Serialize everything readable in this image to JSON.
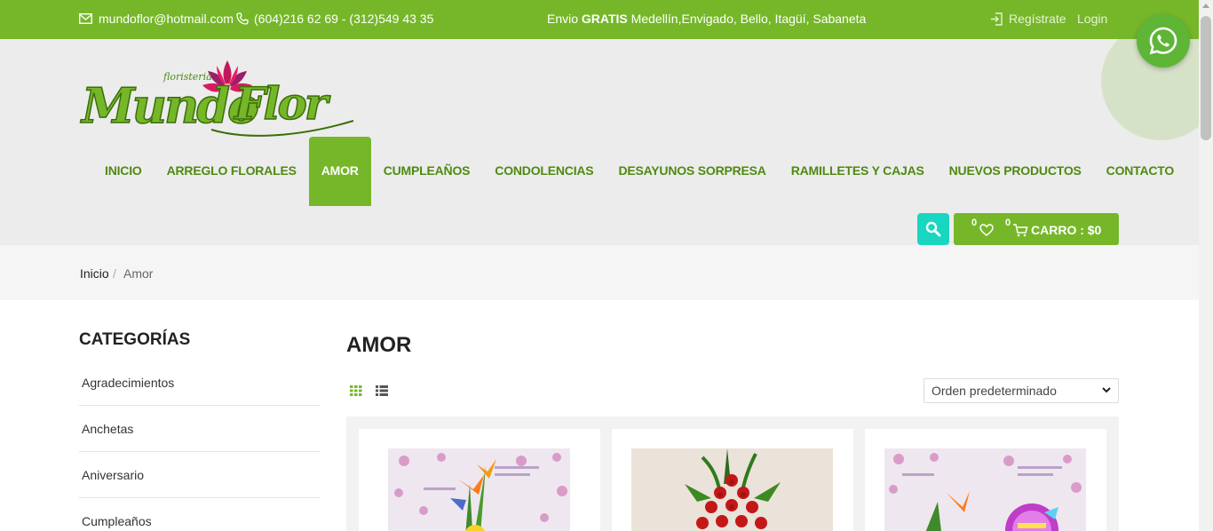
{
  "topbar": {
    "email": "mundoflor@hotmail.com",
    "phone": "(604)216 62 69 - (312)549 43 35",
    "shipping_prefix": "Envio",
    "shipping_bold": "GRATIS",
    "shipping_rest": "Medellín,Envigado, Bello, Itagüí, Sabaneta",
    "register_label": "Regístrate",
    "login_label": "Login"
  },
  "brand": {
    "small": "floristeria",
    "name": "MundoFlor",
    "accent_color": "#76b729",
    "teal_color": "#19d6c0"
  },
  "nav": {
    "items": [
      {
        "label": "INICIO",
        "active": false
      },
      {
        "label": "ARREGLO FLORALES",
        "active": false
      },
      {
        "label": "AMOR",
        "active": true
      },
      {
        "label": "CUMPLEAÑOS",
        "active": false
      },
      {
        "label": "CONDOLENCIAS",
        "active": false
      },
      {
        "label": "DESAYUNOS SORPRESA",
        "active": false
      },
      {
        "label": "RAMILLETES Y CAJAS",
        "active": false
      },
      {
        "label": "NUEVOS PRODUCTOS",
        "active": false
      },
      {
        "label": "CONTACTO",
        "active": false
      }
    ]
  },
  "header_actions": {
    "wishlist_count": "0",
    "cart_count": "0",
    "cart_label": "CARRO : $0"
  },
  "breadcrumb": {
    "home": "Inicio",
    "separator": "/",
    "current": "Amor"
  },
  "sidebar": {
    "title": "CATEGORÍAS",
    "items": [
      "Agradecimientos",
      "Anchetas",
      "Aniversario",
      "Cumpleaños"
    ]
  },
  "main": {
    "title": "AMOR",
    "orderby": "Orden predeterminado"
  },
  "icons": {
    "email": "envelope-icon",
    "phone": "phone-icon",
    "register": "sign-in-icon",
    "whatsapp": "whatsapp-icon",
    "search": "search-icon",
    "wishlist": "heart-icon",
    "cart": "cart-icon",
    "grid": "grid-view-icon",
    "list": "list-view-icon"
  }
}
